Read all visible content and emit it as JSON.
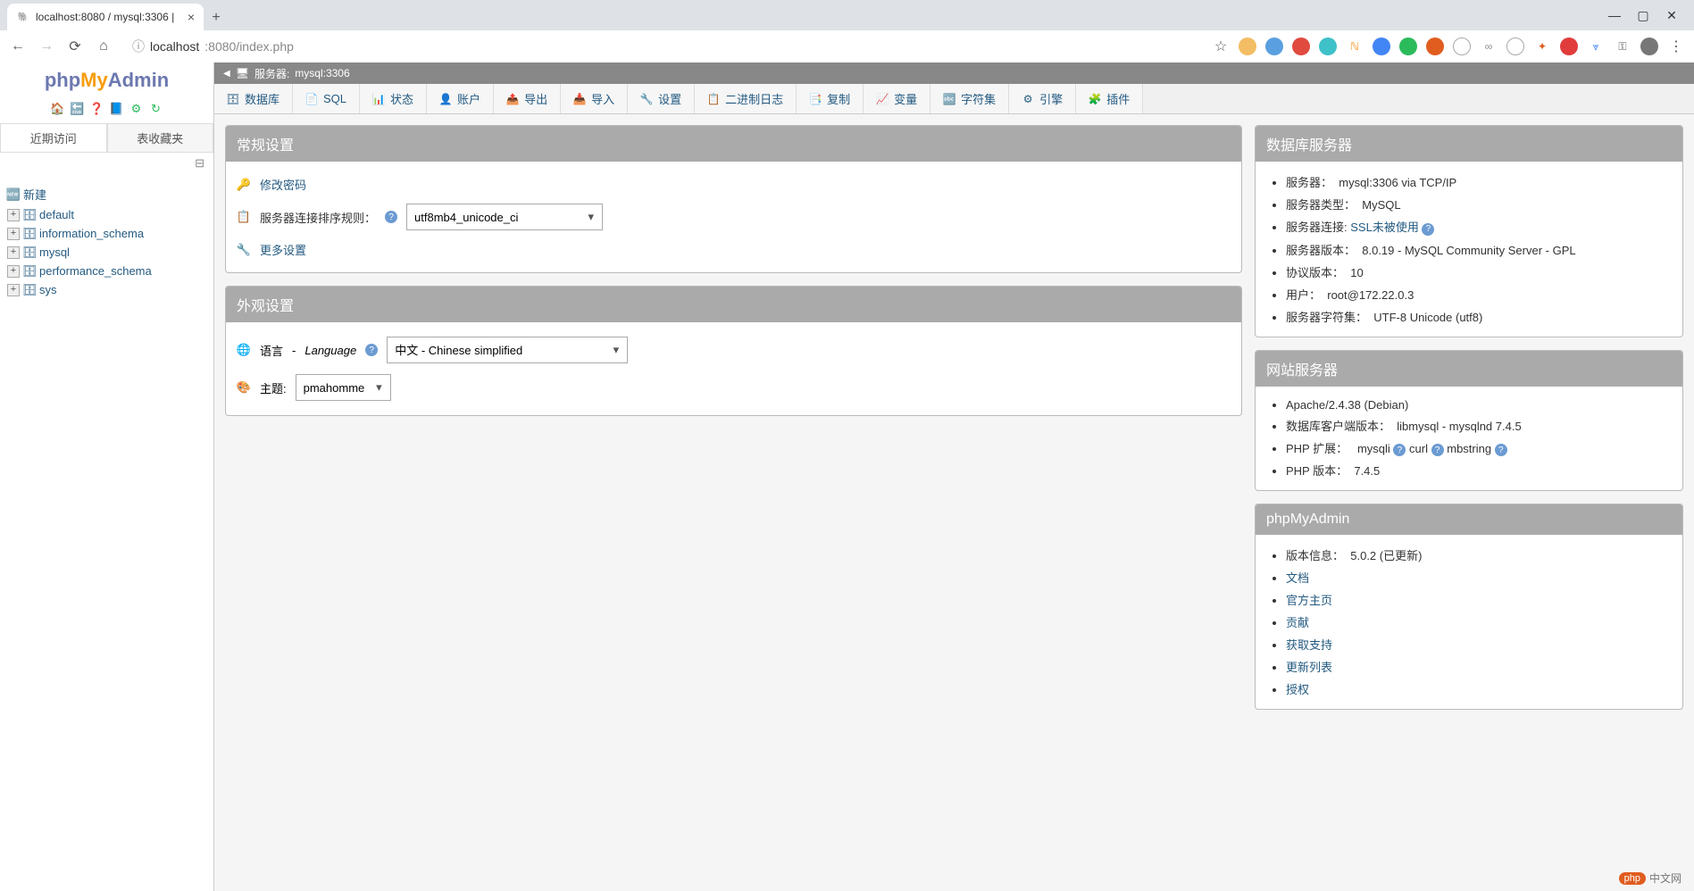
{
  "browser": {
    "tab_title": "localhost:8080 / mysql:3306 |",
    "url_host": "localhost",
    "url_port_path": ":8080/index.php",
    "info_icon_label": "ⓘ"
  },
  "logo": {
    "php": "php",
    "my": "My",
    "admin": "Admin"
  },
  "sidebar": {
    "tabs": [
      "近期访问",
      "表收藏夹"
    ],
    "new_label": "新建",
    "items": [
      "default",
      "information_schema",
      "mysql",
      "performance_schema",
      "sys"
    ]
  },
  "server_bar": {
    "prefix": "服务器:",
    "value": "mysql:3306"
  },
  "top_tabs": [
    {
      "icon": "🗄",
      "label": "数据库"
    },
    {
      "icon": "📄",
      "label": "SQL"
    },
    {
      "icon": "📊",
      "label": "状态"
    },
    {
      "icon": "👤",
      "label": "账户"
    },
    {
      "icon": "📤",
      "label": "导出"
    },
    {
      "icon": "📥",
      "label": "导入"
    },
    {
      "icon": "🔧",
      "label": "设置"
    },
    {
      "icon": "📋",
      "label": "二进制日志"
    },
    {
      "icon": "📑",
      "label": "复制"
    },
    {
      "icon": "📈",
      "label": "变量"
    },
    {
      "icon": "🔤",
      "label": "字符集"
    },
    {
      "icon": "⚙",
      "label": "引擎"
    },
    {
      "icon": "🧩",
      "label": "插件"
    }
  ],
  "general_settings": {
    "title": "常规设置",
    "change_pw": "修改密码",
    "collation_label": "服务器连接排序规则：",
    "collation_value": "utf8mb4_unicode_ci",
    "more": "更多设置"
  },
  "appearance": {
    "title": "外观设置",
    "lang_cn_label": "语言",
    "lang_sep": " - ",
    "lang_en_label": "Language",
    "lang_value": "中文 - Chinese simplified",
    "theme_label": "主题:",
    "theme_value": "pmahomme"
  },
  "db_server": {
    "title": "数据库服务器",
    "rows": [
      {
        "k": "服务器：",
        "v": "mysql:3306 via TCP/IP"
      },
      {
        "k": "服务器类型：",
        "v": "MySQL"
      },
      {
        "k": "服务器连接:",
        "v": "SSL未被使用",
        "red": true,
        "help": true
      },
      {
        "k": "服务器版本：",
        "v": "8.0.19 - MySQL Community Server - GPL"
      },
      {
        "k": "协议版本：",
        "v": "10"
      },
      {
        "k": "用户：",
        "v": "root@172.22.0.3"
      },
      {
        "k": "服务器字符集：",
        "v": "UTF-8 Unicode (utf8)"
      }
    ]
  },
  "web_server": {
    "title": "网站服务器",
    "apache": "Apache/2.4.38 (Debian)",
    "client_label": "数据库客户端版本：",
    "client_value": "libmysql - mysqlnd 7.4.5",
    "php_ext_label": "PHP 扩展：",
    "php_exts": [
      "mysqli",
      "curl",
      "mbstring"
    ],
    "php_ver_label": "PHP 版本：",
    "php_ver_value": "7.4.5"
  },
  "pma_panel": {
    "title": "phpMyAdmin",
    "version_label": "版本信息：",
    "version_value": "5.0.2 (已更新)",
    "links": [
      "文档",
      "官方主页",
      "贡献",
      "获取支持",
      "更新列表",
      "授权"
    ]
  },
  "watermark": {
    "badge": "php",
    "text": "中文网"
  }
}
